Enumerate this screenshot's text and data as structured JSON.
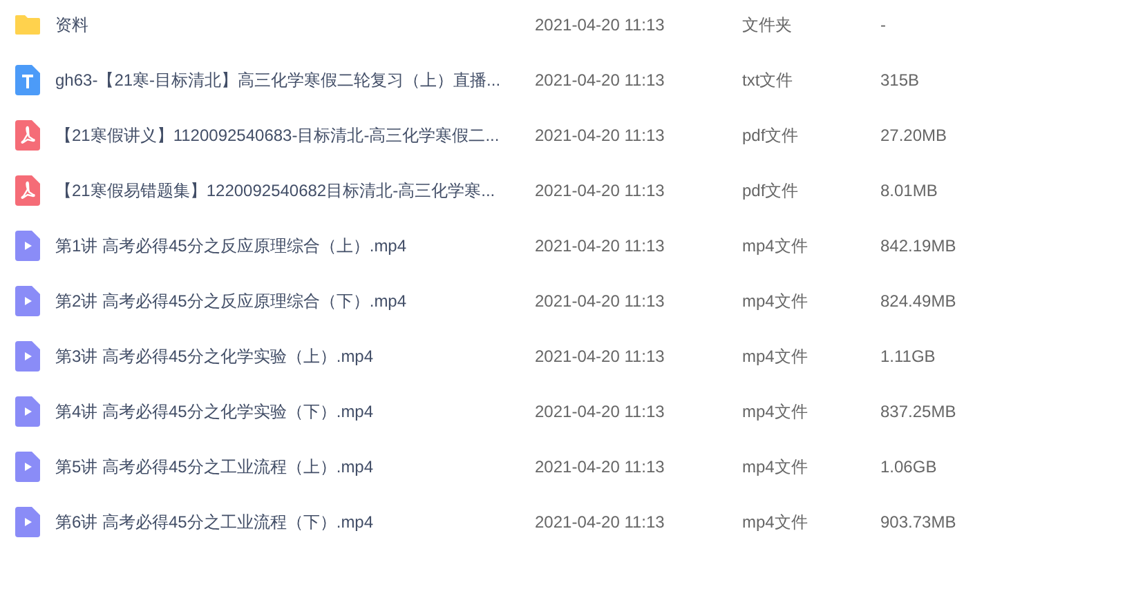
{
  "files": [
    {
      "kind": "folder",
      "name": "资料",
      "modified": "2021-04-20 11:13",
      "type": "文件夹",
      "size": "-"
    },
    {
      "kind": "txt",
      "name": "gh63-【21寒-目标清北】高三化学寒假二轮复习（上）直播...",
      "modified": "2021-04-20 11:13",
      "type": "txt文件",
      "size": "315B"
    },
    {
      "kind": "pdf",
      "name": "【21寒假讲义】1120092540683-目标清北-高三化学寒假二...",
      "modified": "2021-04-20 11:13",
      "type": "pdf文件",
      "size": "27.20MB"
    },
    {
      "kind": "pdf",
      "name": "【21寒假易错题集】1220092540682目标清北-高三化学寒...",
      "modified": "2021-04-20 11:13",
      "type": "pdf文件",
      "size": "8.01MB"
    },
    {
      "kind": "video",
      "name": "第1讲 高考必得45分之反应原理综合（上）.mp4",
      "modified": "2021-04-20 11:13",
      "type": "mp4文件",
      "size": "842.19MB"
    },
    {
      "kind": "video",
      "name": "第2讲 高考必得45分之反应原理综合（下）.mp4",
      "modified": "2021-04-20 11:13",
      "type": "mp4文件",
      "size": "824.49MB"
    },
    {
      "kind": "video",
      "name": "第3讲 高考必得45分之化学实验（上）.mp4",
      "modified": "2021-04-20 11:13",
      "type": "mp4文件",
      "size": "1.11GB"
    },
    {
      "kind": "video",
      "name": "第4讲 高考必得45分之化学实验（下）.mp4",
      "modified": "2021-04-20 11:13",
      "type": "mp4文件",
      "size": "837.25MB"
    },
    {
      "kind": "video",
      "name": "第5讲 高考必得45分之工业流程（上）.mp4",
      "modified": "2021-04-20 11:13",
      "type": "mp4文件",
      "size": "1.06GB"
    },
    {
      "kind": "video",
      "name": "第6讲 高考必得45分之工业流程（下）.mp4",
      "modified": "2021-04-20 11:13",
      "type": "mp4文件",
      "size": "903.73MB"
    }
  ]
}
